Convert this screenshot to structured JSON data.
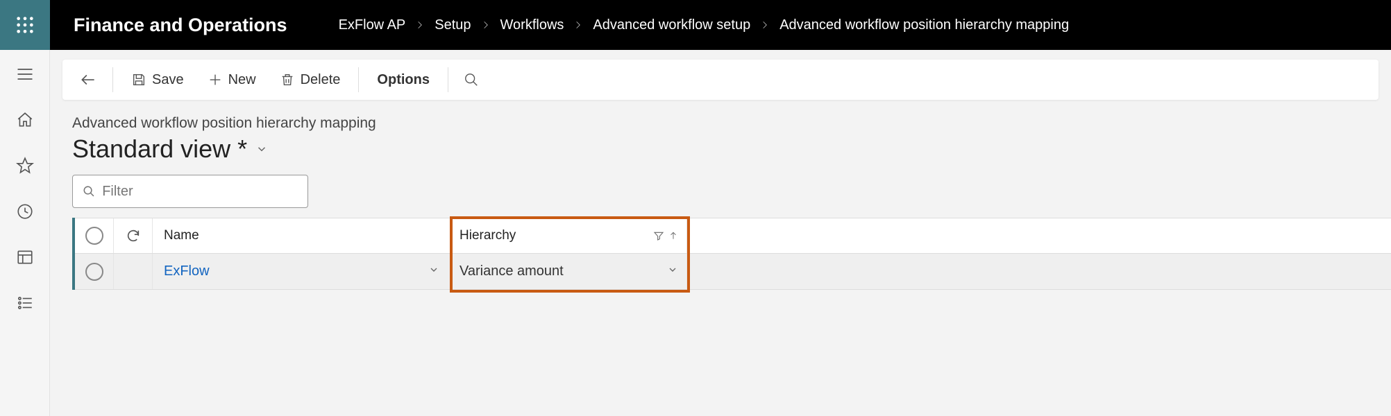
{
  "app": {
    "title": "Finance and Operations"
  },
  "breadcrumb": {
    "items": [
      {
        "label": "ExFlow AP"
      },
      {
        "label": "Setup"
      },
      {
        "label": "Workflows"
      },
      {
        "label": "Advanced workflow setup"
      },
      {
        "label": "Advanced workflow position hierarchy mapping"
      }
    ]
  },
  "toolbar": {
    "save": "Save",
    "new": "New",
    "delete": "Delete",
    "options": "Options"
  },
  "page": {
    "subtitle": "Advanced workflow position hierarchy mapping",
    "view_title": "Standard view",
    "view_dirty_marker": "*"
  },
  "filter": {
    "placeholder": "Filter"
  },
  "grid": {
    "columns": {
      "name": "Name",
      "hierarchy": "Hierarchy"
    },
    "rows": [
      {
        "name": "ExFlow",
        "hierarchy": "Variance amount"
      }
    ]
  }
}
